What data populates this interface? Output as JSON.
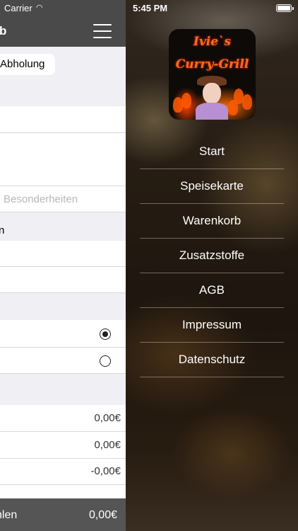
{
  "statusbar": {
    "carrier": "Carrier",
    "time": "5:45 PM"
  },
  "left_panel": {
    "nav_title": "b",
    "pickup_option": "Abholung",
    "remarks_placeholder": "Besonderheiten",
    "section_row_text": "n",
    "prices": [
      "0,00€",
      "0,00€",
      "-0,00€"
    ],
    "footer_label": "hlen",
    "footer_total": "0,00€"
  },
  "logo": {
    "line1": "Ivie`s",
    "line2": "Curry-Grill"
  },
  "menu": {
    "items": [
      "Start",
      "Speisekarte",
      "Warenkorb",
      "Zusatzstoffe",
      "AGB",
      "Impressum",
      "Datenschutz"
    ]
  },
  "colors": {
    "nav_bar": "#4a4a4a",
    "footer": "#555555",
    "logo_text": "#ff6a1a"
  }
}
